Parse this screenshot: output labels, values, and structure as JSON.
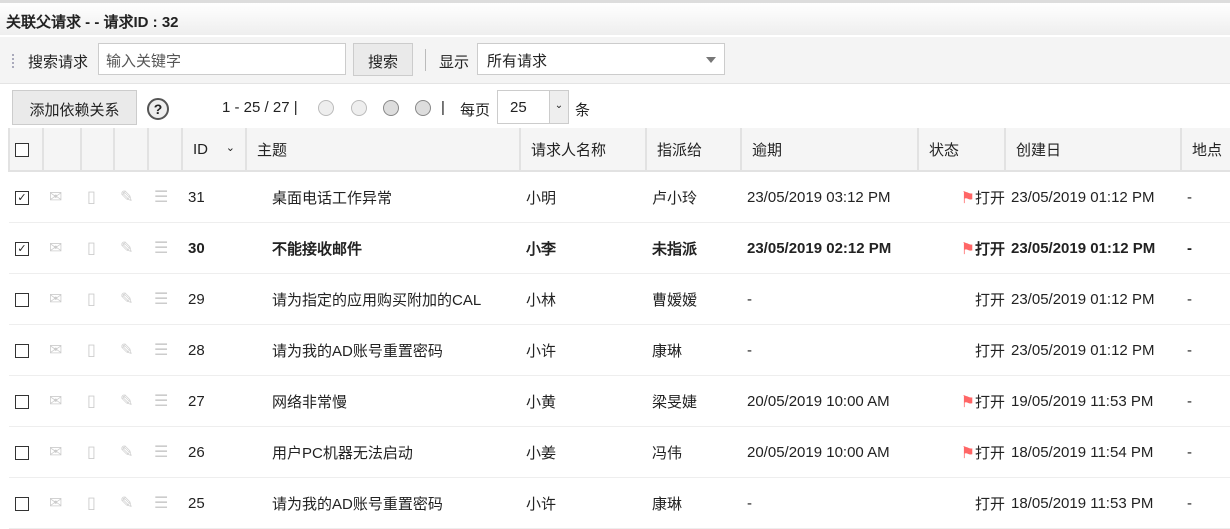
{
  "title": "关联父请求 - - 请求ID : 32",
  "toolbar": {
    "search_label": "搜索请求",
    "search_placeholder": "输入关键字",
    "search_button": "搜索",
    "show_label": "显示",
    "show_value": "所有请求"
  },
  "actions": {
    "add_dependency": "添加依赖关系",
    "help": "?",
    "range": "1 - 25 / 27",
    "per_page_label": "每页",
    "per_page": "25",
    "unit": "条"
  },
  "columns": [
    "ID",
    "主题",
    "请求人名称",
    "指派给",
    "逾期",
    "状态",
    "创建日",
    "地点"
  ],
  "rows": [
    {
      "checked": true,
      "bold": false,
      "id": "31",
      "subject": "桌面电话工作异常",
      "requester": "小明",
      "assignee": "卢小玲",
      "due": "23/05/2019 03:12 PM",
      "flag": true,
      "status": "打开",
      "created": "23/05/2019 01:12 PM",
      "site": "-"
    },
    {
      "checked": true,
      "bold": true,
      "id": "30",
      "subject": "不能接收邮件",
      "requester": "小李",
      "assignee": "未指派",
      "due": "23/05/2019 02:12 PM",
      "flag": true,
      "status": "打开",
      "created": "23/05/2019 01:12 PM",
      "site": "-"
    },
    {
      "checked": false,
      "bold": false,
      "id": "29",
      "subject": "请为指定的应用购买附加的CAL",
      "requester": "小林",
      "assignee": "曹嫒嫒",
      "due": "-",
      "flag": false,
      "status": "打开",
      "created": "23/05/2019 01:12 PM",
      "site": "-"
    },
    {
      "checked": false,
      "bold": false,
      "id": "28",
      "subject": "请为我的AD账号重置密码",
      "requester": "小许",
      "assignee": "康琳",
      "due": "-",
      "flag": false,
      "status": "打开",
      "created": "23/05/2019 01:12 PM",
      "site": "-"
    },
    {
      "checked": false,
      "bold": false,
      "id": "27",
      "subject": "网络非常慢",
      "requester": "小黄",
      "assignee": "梁旻婕",
      "due": "20/05/2019 10:00 AM",
      "flag": true,
      "status": "打开",
      "created": "19/05/2019 11:53 PM",
      "site": "-"
    },
    {
      "checked": false,
      "bold": false,
      "id": "26",
      "subject": "用户PC机器无法启动",
      "requester": "小姜",
      "assignee": "冯伟",
      "due": "20/05/2019 10:00 AM",
      "flag": true,
      "status": "打开",
      "created": "18/05/2019 11:54 PM",
      "site": "-"
    },
    {
      "checked": false,
      "bold": false,
      "id": "25",
      "subject": "请为我的AD账号重置密码",
      "requester": "小许",
      "assignee": "康琳",
      "due": "-",
      "flag": false,
      "status": "打开",
      "created": "18/05/2019 11:53 PM",
      "site": "-"
    }
  ]
}
